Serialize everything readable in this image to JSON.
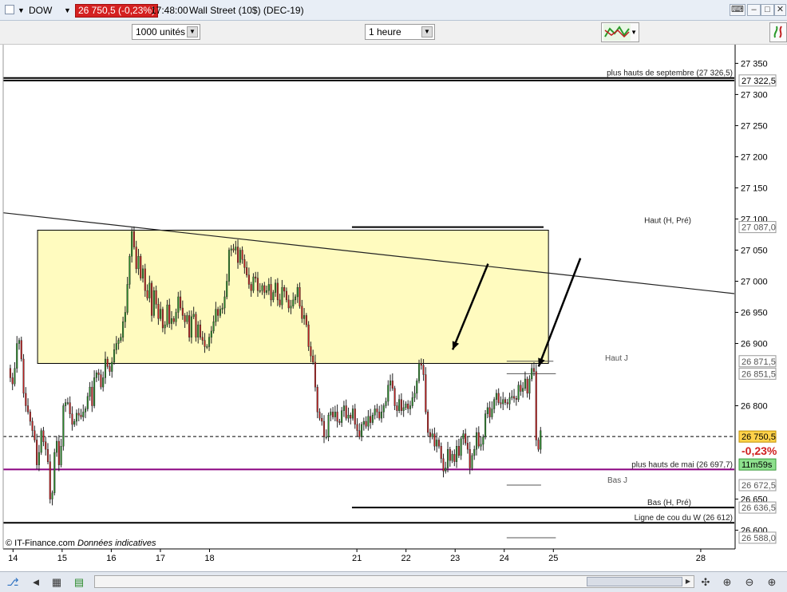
{
  "window": {
    "symbol": "DOW",
    "price_badge": "26 750,5 (-0,23%)",
    "time": "17:48:00",
    "instrument": "Wall Street (10$) (DEC-19)"
  },
  "toolbar": {
    "units_value": "1000 unités",
    "interval_value": "1 heure"
  },
  "chart": {
    "y_axis_ticks": [
      "27 350",
      "27 300",
      "27 250",
      "27 200",
      "27 150",
      "27 100",
      "27 050",
      "27 000",
      "26 950",
      "26 900",
      "26 800",
      "26 650",
      "26 600"
    ],
    "x_axis_ticks": [
      "14",
      "15",
      "16",
      "17",
      "18",
      "21",
      "22",
      "23",
      "24",
      "25",
      "28"
    ],
    "price_tags": [
      {
        "label": "27 322,5",
        "style": "box"
      },
      {
        "label": "27 087,0",
        "style": "box"
      },
      {
        "label": "26 871,5",
        "style": "box"
      },
      {
        "label": "26 851,5",
        "style": "box"
      },
      {
        "label": "26 750,5",
        "style": "current"
      },
      {
        "label": "-0,23%",
        "style": "change"
      },
      {
        "label": "11m59s",
        "style": "timer"
      },
      {
        "label": "26 672,5",
        "style": "box"
      },
      {
        "label": "26 636,5",
        "style": "box"
      },
      {
        "label": "26 588,0",
        "style": "box"
      }
    ],
    "annotations": [
      "plus hauts de septembre (27 326,5)",
      "Haut (H, Pré)",
      "Haut J",
      "plus hauts de mai (26 697,7)",
      "Bas J",
      "Bas (H, Pré)",
      "Ligne de cou du W (26 612)"
    ],
    "footer_brand": "© IT-Finance.com",
    "footer_note": "Données indicatives",
    "colors": {
      "zone": "#fffbbf",
      "bull": "#2a8a2a",
      "bear": "#c02020",
      "trend": "#222222",
      "may_high": "#8a0080"
    }
  },
  "chart_data": {
    "type": "candlestick",
    "y_range": [
      26570,
      27380
    ],
    "x_range": [
      13.8,
      28.7
    ],
    "price": [
      26860,
      26845,
      26835,
      26860,
      26900,
      26905,
      26875,
      26820,
      26800,
      26790,
      26775,
      26760,
      26745,
      26705,
      26725,
      26760,
      26742,
      26730,
      26710,
      26650,
      26660,
      26725,
      26743,
      26705,
      26735,
      26800,
      26805,
      26805,
      26787,
      26770,
      26775,
      26788,
      26785,
      26782,
      26790,
      26795,
      26815,
      26830,
      26800,
      26845,
      26853,
      26850,
      26830,
      26845,
      26875,
      26863,
      26855,
      26870,
      26890,
      26900,
      26905,
      26910,
      26935,
      26950,
      26995,
      27040,
      27080,
      27055,
      27020,
      27040,
      27005,
      27020,
      26985,
      26973,
      26997,
      26945,
      26985,
      26963,
      26940,
      26955,
      26925,
      26930,
      26962,
      26932,
      26940,
      26935,
      26950,
      26975,
      26957,
      26945,
      26935,
      26945,
      26910,
      26943,
      26947,
      26910,
      26930,
      26910,
      26905,
      26895,
      26895,
      26910,
      26920,
      26935,
      26955,
      26945,
      26955,
      26957,
      26975,
      27000,
      27050,
      27052,
      27050,
      27055,
      27030,
      27050,
      27035,
      27022,
      27010,
      26995,
      26985,
      27007,
      27005,
      26985,
      26985,
      26993,
      26982,
      26985,
      26995,
      26970,
      26982,
      26997,
      26970,
      26962,
      26990,
      26984,
      26970,
      26957,
      26960,
      26970,
      26975,
      26990,
      26960,
      26940,
      26945,
      26930,
      26895,
      26880,
      26870,
      26830,
      26790,
      26780,
      26775,
      26750,
      26750,
      26785,
      26790,
      26782,
      26790,
      26775,
      26773,
      26792,
      26800,
      26780,
      26785,
      26780,
      26795,
      26770,
      26760,
      26750,
      26770,
      26775,
      26767,
      26783,
      26773,
      26785,
      26795,
      26790,
      26780,
      26790,
      26800,
      26807,
      26833,
      26840,
      26828,
      26800,
      26792,
      26810,
      26792,
      26797,
      26803,
      26795,
      26800,
      26813,
      26820,
      26840,
      26868,
      26865,
      26850,
      26790,
      26757,
      26750,
      26755,
      26735,
      26745,
      26735,
      26715,
      26695,
      26700,
      26730,
      26712,
      26722,
      26710,
      26735,
      26720,
      26747,
      26755,
      26740,
      26730,
      26700,
      26720,
      26730,
      26757,
      26735,
      26738,
      26750,
      26787,
      26797,
      26782,
      26795,
      26810,
      26820,
      26805,
      26803,
      26810,
      26805,
      26803,
      26813,
      26815,
      26812,
      26810,
      26833,
      26823,
      26828,
      26843,
      26820,
      26843,
      26860,
      26855,
      26745,
      26730,
      26760
    ],
    "overlays": {
      "yellow_zone": {
        "y": [
          26868,
          27082
        ],
        "x": [
          14.5,
          24.9
        ]
      },
      "trendline": {
        "from": [
          13.8,
          27110
        ],
        "to": [
          28.7,
          26980
        ]
      },
      "horizontals": [
        {
          "y": 27326.5,
          "x": [
            13.8,
            28.7
          ],
          "color": "#000000",
          "width": 2
        },
        {
          "y": 27322.5,
          "x": [
            13.8,
            28.7
          ],
          "color": "#000000",
          "width": 2
        },
        {
          "y": 27087.0,
          "x": [
            20.9,
            24.8
          ],
          "color": "#000000",
          "width": 2
        },
        {
          "y": 26871.5,
          "x": [
            24.05,
            25.0
          ],
          "color": "#555555",
          "width": 1
        },
        {
          "y": 26851.5,
          "x": [
            24.05,
            25.05
          ],
          "color": "#555555",
          "width": 1
        },
        {
          "y": 26750.5,
          "x": [
            13.8,
            28.7
          ],
          "color": "#000000",
          "width": 1,
          "dashed": true
        },
        {
          "y": 26697.7,
          "x": [
            13.8,
            28.7
          ],
          "color": "#8a0080",
          "width": 2
        },
        {
          "y": 26672.5,
          "x": [
            24.05,
            24.75
          ],
          "color": "#555555",
          "width": 1
        },
        {
          "y": 26636.5,
          "x": [
            20.9,
            28.7
          ],
          "color": "#000000",
          "width": 2
        },
        {
          "y": 26612.0,
          "x": [
            13.8,
            28.7
          ],
          "color": "#000000",
          "width": 2
        },
        {
          "y": 26588.0,
          "x": [
            24.05,
            25.05
          ],
          "color": "#555555",
          "width": 1
        }
      ],
      "arrows": [
        {
          "from": [
            23.67,
            27028
          ],
          "to": [
            22.95,
            26890
          ]
        },
        {
          "from": [
            25.55,
            27037
          ],
          "to": [
            24.7,
            26863
          ]
        }
      ]
    }
  }
}
